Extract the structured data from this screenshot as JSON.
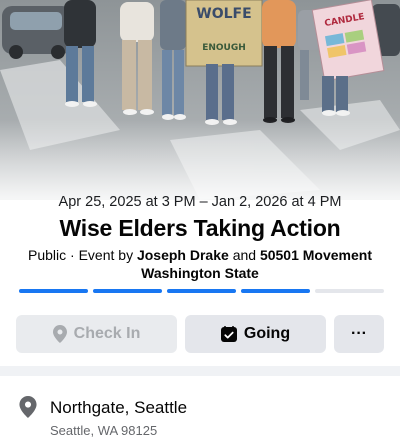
{
  "cover": {
    "sign_left_text": "WOLFE",
    "sign_center_text": "ENOUGH",
    "sign_right_text": "CANDLE"
  },
  "event": {
    "dates": "Apr 25, 2025 at 3 PM – Jan 2, 2026 at 4 PM",
    "title": "Wise Elders Taking Action",
    "privacy": "Public",
    "hosted_prefix": "Event by",
    "host_1": "Joseph Drake",
    "and_word": "and",
    "host_2": "50501 Movement",
    "host_3": "Washington State"
  },
  "pager": {
    "total": 5,
    "active_count": 4
  },
  "actions": {
    "check_in_label": "Check In",
    "going_label": "Going",
    "more_label": "···",
    "check_in_icon": "location-pin-icon",
    "going_icon": "calendar-check-icon",
    "more_icon": "ellipsis-icon"
  },
  "location": {
    "name": "Northgate, Seattle",
    "address": "Seattle, WA 98125",
    "icon": "location-pin-icon"
  },
  "colors": {
    "accent": "#1877f2",
    "button_bg": "#e4e6eb",
    "muted_text": "#65676b"
  }
}
